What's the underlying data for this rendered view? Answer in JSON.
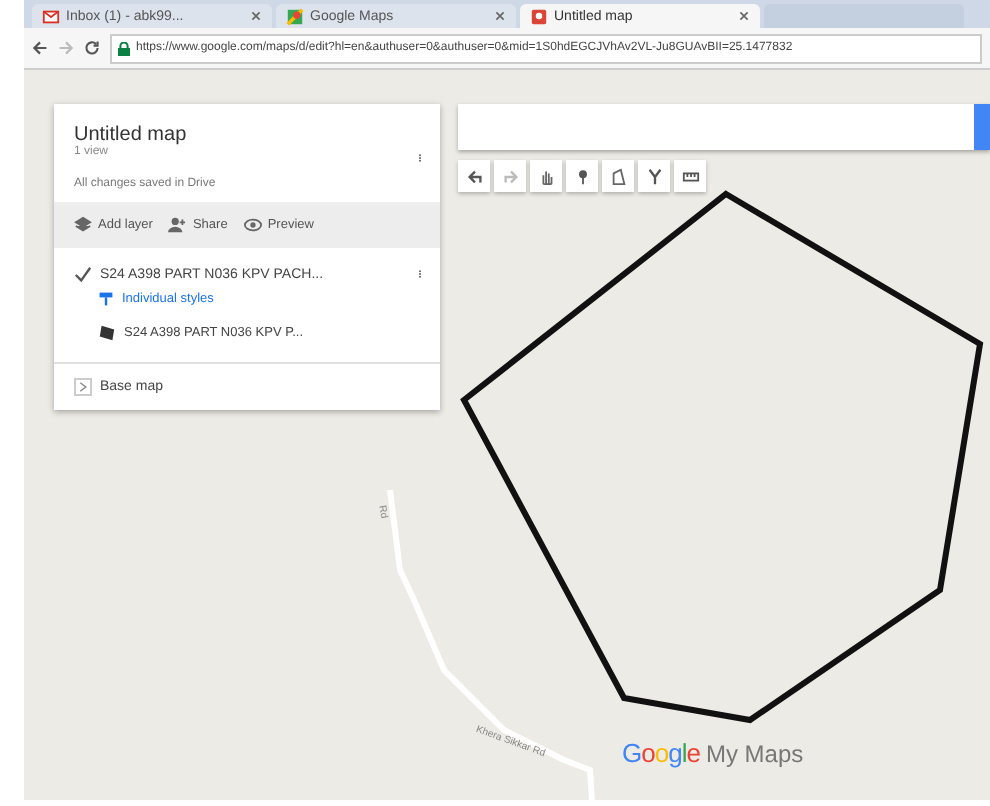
{
  "browser": {
    "tabs": [
      {
        "title": "Inbox (1) - abk99...",
        "selected": false
      },
      {
        "title": "Google Maps",
        "selected": false
      },
      {
        "title": "Untitled map",
        "selected": true
      }
    ],
    "url": "https://www.google.com/maps/d/edit?hl=en&authuser=0&authuser=0&mid=1S0hdEGCJVhAv2VL-Ju8GUAvBII=25.1477832"
  },
  "panel": {
    "title": "Untitled map",
    "subtitle": "1 view",
    "status": "All changes saved in Drive",
    "actions": [
      {
        "label": "Add layer",
        "kind": "layer"
      },
      {
        "label": "Share",
        "kind": "share"
      },
      {
        "label": "Preview",
        "kind": "preview"
      }
    ],
    "layer": {
      "name": "S24 A398 PART N036 KPV PACH...",
      "checked": true,
      "style": "Individual styles",
      "items": [
        {
          "name": "S24 A398 PART N036 KPV P..."
        }
      ]
    },
    "base_map": {
      "label": "Base map",
      "expanded": false
    }
  },
  "toolbar": [
    {
      "kind": "undo"
    },
    {
      "kind": "redo"
    },
    {
      "kind": "hand"
    },
    {
      "kind": "marker"
    },
    {
      "kind": "polygon"
    },
    {
      "kind": "route"
    },
    {
      "kind": "ruler"
    }
  ],
  "map": {
    "roads": [
      {
        "label": "Rd"
      },
      {
        "label": "Khera Sikkar Rd"
      }
    ],
    "logo": {
      "brand": "Google",
      "product": "My Maps"
    }
  }
}
